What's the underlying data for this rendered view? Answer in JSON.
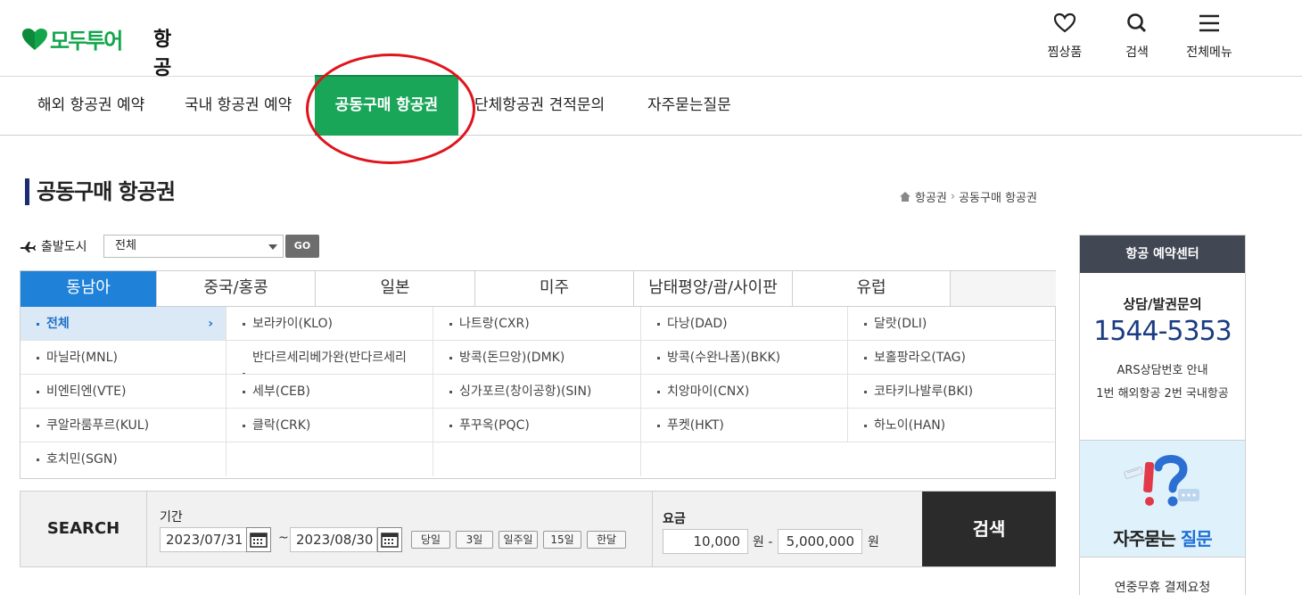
{
  "header": {
    "brand": "모두투어",
    "category": "항공",
    "icons": [
      {
        "name": "heart-icon",
        "label": "찜상품"
      },
      {
        "name": "search-icon",
        "label": "검색"
      },
      {
        "name": "menu-icon",
        "label": "전체메뉴"
      }
    ]
  },
  "nav": {
    "items": [
      {
        "label": "해외 항공권 예약"
      },
      {
        "label": "국내 항공권 예약"
      },
      {
        "label": "공동구매 항공권",
        "active": true
      },
      {
        "label": "단체항공권 견적문의"
      },
      {
        "label": "자주묻는질문"
      }
    ]
  },
  "page": {
    "title": "공동구매 항공권",
    "breadcrumb": [
      "항공권",
      "공동구매 항공권"
    ]
  },
  "departure": {
    "label": "출발도시",
    "selected": "전체",
    "go_label": "GO"
  },
  "regions": {
    "tabs": [
      {
        "label": "동남아",
        "active": true
      },
      {
        "label": "중국/홍콩"
      },
      {
        "label": "일본"
      },
      {
        "label": "미주"
      },
      {
        "label": "남태평양/괌/사이판"
      },
      {
        "label": "유럽"
      }
    ],
    "cities": [
      "전체",
      "보라카이(KLO)",
      "나트랑(CXR)",
      "다낭(DAD)",
      "달랏(DLI)",
      "마닐라(MNL)",
      "반다르세리베가완(반다르세리",
      "방콕(돈므앙)(DMK)",
      "방콕(수완나폼)(BKK)",
      "보홀팡라오(TAG)",
      "비엔티엔(VTE)",
      "세부(CEB)",
      "싱가포르(창이공항)(SIN)",
      "치앙마이(CNX)",
      "코타키나발루(BKI)",
      "쿠알라룸푸르(KUL)",
      "클락(CRK)",
      "푸꾸옥(PQC)",
      "푸켓(HKT)",
      "하노이(HAN)",
      "호치민(SGN)"
    ]
  },
  "search": {
    "label": "SEARCH",
    "period_label": "기간",
    "date_from": "2023/07/31",
    "date_to": "2023/08/30",
    "tilde": "~",
    "period_buttons": [
      "당일",
      "3일",
      "일주일",
      "15일",
      "한달"
    ],
    "fee_label": "요금",
    "fee_min": "10,000",
    "fee_max": "5,000,000",
    "won": "원",
    "won_dash": "원 -",
    "submit": "검색"
  },
  "sidebar": {
    "title": "항공 예약센터",
    "consult": "상담/발권문의",
    "phone": "1544-5353",
    "ars1": "ARS상담번호 안내",
    "ars2": "1번 해외항공 2번 국내항공",
    "faq_a": "자주묻는 ",
    "faq_b": "질문",
    "bottom": "연중무휴 결제요청"
  },
  "colors": {
    "brand_green": "#1aa659",
    "tab_blue": "#1f82d8",
    "annotation_red": "#e0141c"
  }
}
